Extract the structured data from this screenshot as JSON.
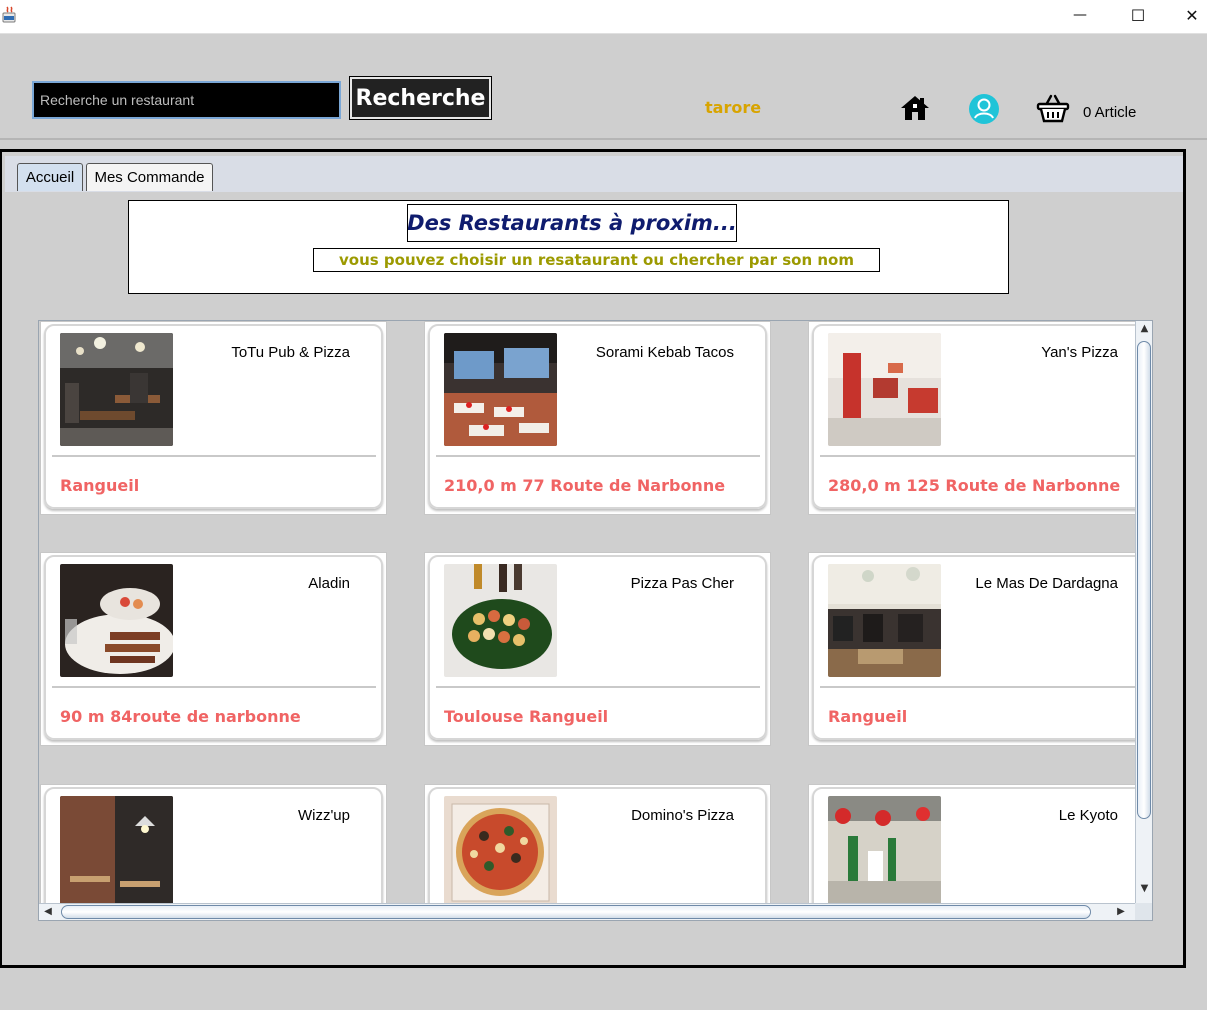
{
  "window": {
    "minimize": "—",
    "maximize": "☐",
    "close": "✕"
  },
  "header": {
    "search_placeholder": "Recherche un restaurant",
    "search_button": "Recherche",
    "username": "tarore",
    "cart_count": "0 Article"
  },
  "tabs": [
    {
      "label": "Accueil",
      "selected": true
    },
    {
      "label": "Mes Commande",
      "selected": false
    }
  ],
  "banner": {
    "title": "Des Restaurants à proxim...",
    "subtitle": "vous pouvez choisir un resataurant ou chercher par son nom"
  },
  "restaurants": [
    {
      "name": "ToTu Pub & Pizza",
      "address": "Rangueil",
      "photo": "restaurant-interior-photo"
    },
    {
      "name": "Sorami Kebab Tacos",
      "address": "210,0 m 77 Route de Narbonne",
      "photo": "restaurant-interior-photo"
    },
    {
      "name": "Yan's Pizza",
      "address": "280,0 m 125 Route de Narbonne",
      "photo": "restaurant-interior-photo"
    },
    {
      "name": "Aladin",
      "address": "90 m 84route de narbonne",
      "photo": "food-platter-photo"
    },
    {
      "name": "Pizza Pas Cher",
      "address": "Toulouse Rangueil",
      "photo": "food-platter-photo"
    },
    {
      "name": "Le Mas De Dardagna",
      "address": "Rangueil",
      "photo": "restaurant-interior-photo"
    },
    {
      "name": "Wizz'up",
      "address": "",
      "photo": "restaurant-interior-photo"
    },
    {
      "name": "Domino's Pizza",
      "address": "",
      "photo": "pizza-photo"
    },
    {
      "name": "Le Kyoto",
      "address": "",
      "photo": "restaurant-interior-photo"
    }
  ],
  "colors": {
    "username": "#d8a400",
    "banner_title": "#0f1c6e",
    "banner_subtitle": "#9c9a00",
    "address": "#f06464",
    "tab_selected": "#d3e0ef",
    "user_icon": "#20c4d8"
  },
  "icons": {
    "home": "home-icon",
    "user": "user-icon",
    "cart": "basket-icon"
  }
}
